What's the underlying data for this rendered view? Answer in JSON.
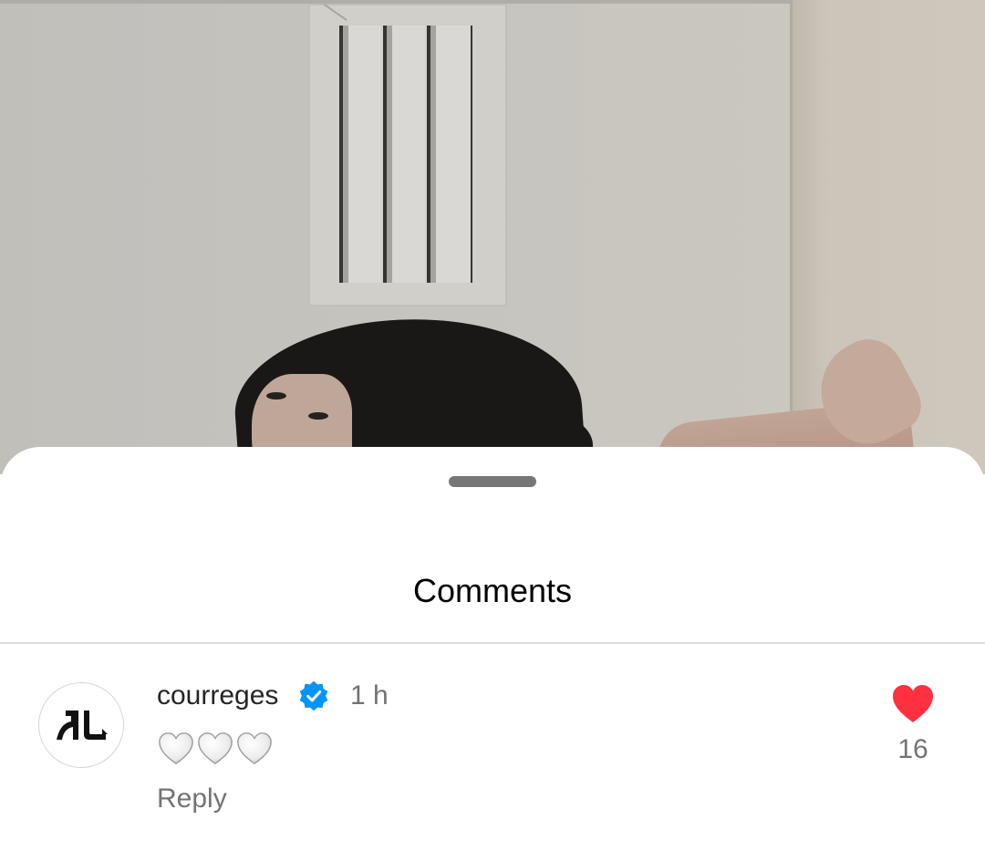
{
  "sheet": {
    "title": "Comments"
  },
  "comments": [
    {
      "username": "courreges",
      "verified": true,
      "time": "1 h",
      "text": "🤍🤍🤍",
      "reply_label": "Reply",
      "liked": true,
      "like_count": "16"
    }
  ],
  "colors": {
    "like_red": "#ff3040",
    "verified_blue": "#0095f6",
    "secondary_text": "#737373"
  },
  "icons": [
    "verified-badge-icon",
    "heart-icon",
    "white-heart-emoji",
    "courreges-logo"
  ]
}
